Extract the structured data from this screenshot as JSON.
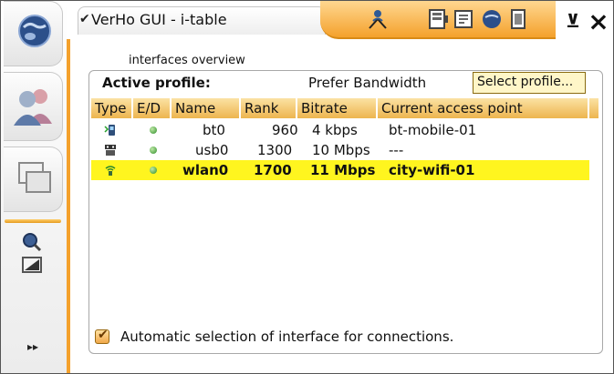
{
  "window": {
    "title": "VerHo GUI - i-table",
    "title_check_glyph": "✔",
    "close_glyph": "×",
    "minimize_glyph": "⊻"
  },
  "taskbar": {
    "items": [
      {
        "name": "browser-icon"
      },
      {
        "name": "contacts-icon"
      },
      {
        "name": "applications-icon"
      },
      {
        "name": "search-icon"
      },
      {
        "name": "image-icon"
      }
    ],
    "more_glyph": "▸▸"
  },
  "status_icons": [
    "connectivity-icon",
    "battery-icon",
    "clock-icon",
    "display-icon",
    "globe-icon"
  ],
  "panel": {
    "caption": "interfaces overview",
    "active_profile_label": "Active profile:",
    "active_profile_value": "Prefer Bandwidth",
    "select_profile_label": "Select profile..."
  },
  "table": {
    "columns": [
      "Type",
      "E/D",
      "Name",
      "Rank",
      "Bitrate",
      "Current access point"
    ],
    "rows": [
      {
        "type_icon": "bluetooth-phone-icon",
        "enabled": true,
        "name": "bt0",
        "rank": "960",
        "bitrate": "4 kbps",
        "access_point": "bt-mobile-01",
        "selected": false
      },
      {
        "type_icon": "usb-icon",
        "enabled": true,
        "name": "usb0",
        "rank": "1300",
        "bitrate": "10 Mbps",
        "access_point": "---",
        "selected": false
      },
      {
        "type_icon": "wifi-icon",
        "enabled": true,
        "name": "wlan0",
        "rank": "1700",
        "bitrate": "11 Mbps",
        "access_point": "city-wifi-01",
        "selected": true
      }
    ]
  },
  "auto_select": {
    "checked": true,
    "label": "Automatic selection of interface for connections."
  },
  "colors": {
    "accent": "#f4a12c",
    "header": "#edb54e",
    "selected_row": "#fff51f"
  }
}
